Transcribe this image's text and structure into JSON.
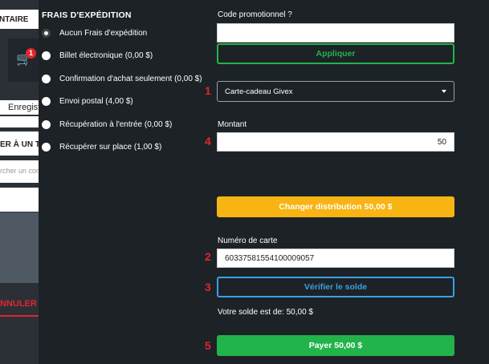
{
  "background_page": {
    "header_partial": "NTAIRE",
    "cart_badge_count": "1",
    "save_partial": "Enregist",
    "attach_partial": "ER À UN TIE",
    "search_partial": "rcher un con",
    "cancel_partial": "NNULER LA"
  },
  "shipping": {
    "title": "FRAIS D'EXPÉDITION",
    "options": [
      {
        "label": "Aucun Frais d'expédition",
        "selected": true
      },
      {
        "label": "Billet électronique (0,00 $)",
        "selected": false
      },
      {
        "label": "Confirmation d'achat seulement (0,00 $)",
        "selected": false
      },
      {
        "label": "Envoi postal (4,00 $)",
        "selected": false
      },
      {
        "label": "Récupération à l'entrée (0,00 $)",
        "selected": false
      },
      {
        "label": "Récupérer sur place (1,00 $)",
        "selected": false
      }
    ]
  },
  "payment": {
    "promo_label": "Code promotionnel ?",
    "promo_value": "",
    "apply_button": "Appliquer",
    "method_selected": "Carte-cadeau Givex",
    "amount_label": "Montant",
    "amount_value": "50",
    "distribution_button": "Changer distribution 50,00 $",
    "card_number_label": "Numéro de carte",
    "card_number_value": "60337581554100009057",
    "verify_button": "Vérifier le solde",
    "balance_text": "Votre solde est de: 50,00 $",
    "pay_button": "Payer 50,00 $"
  },
  "step_markers": {
    "s1": "1",
    "s2": "2",
    "s3": "3",
    "s4": "4",
    "s5": "5"
  },
  "colors": {
    "background": "#1d2227",
    "green": "#22b34b",
    "orange": "#f7b412",
    "blue": "#3aa0e0",
    "red": "#e0262b"
  }
}
